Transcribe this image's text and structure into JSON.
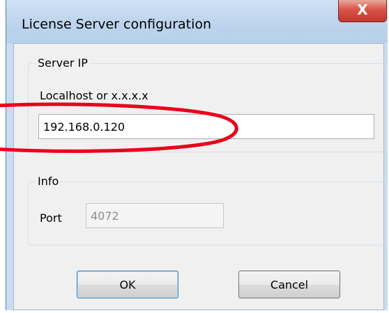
{
  "window": {
    "title": "License Server configuration",
    "close_glyph": "X"
  },
  "server_ip": {
    "group_label": "Server IP",
    "hint": "Localhost or x.x.x.x",
    "value": "192.168.0.120"
  },
  "info": {
    "group_label": "Info",
    "port_label": "Port",
    "port_value": "4072"
  },
  "buttons": {
    "ok": "OK",
    "cancel": "Cancel"
  },
  "annotation": {
    "color": "#e8001c"
  }
}
